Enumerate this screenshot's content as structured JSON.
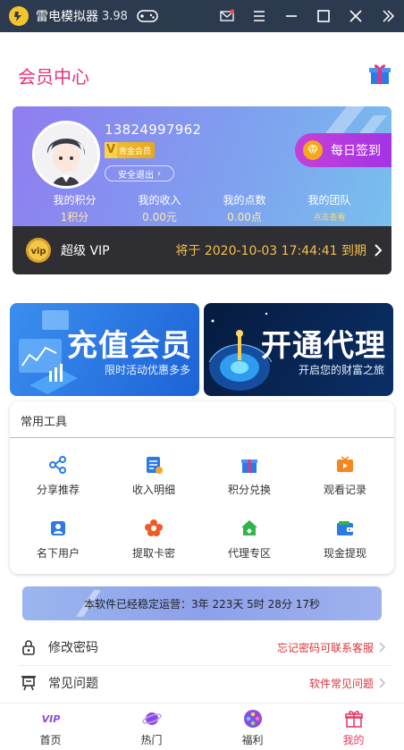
{
  "titlebar": {
    "app_name": "雷电模拟器",
    "version": "3.98"
  },
  "header": {
    "title": "会员中心"
  },
  "member": {
    "phone": "13824997962",
    "level_badge": "青金会员",
    "logout_label": "安全退出",
    "signin_label": "每日签到",
    "stats": [
      {
        "label": "我的积分",
        "value": "1积分"
      },
      {
        "label": "我的收入",
        "value": "0.00元"
      },
      {
        "label": "我的点数",
        "value": "0.00点"
      },
      {
        "label": "我的团队",
        "value": "点击查看"
      }
    ],
    "vip": {
      "label": "超级 VIP",
      "expire_text": "将于 2020-10-03 17:44:41 到期"
    }
  },
  "banners": {
    "left": {
      "title": "充值会员",
      "subtitle": "限时活动优惠多多"
    },
    "right": {
      "title": "开通代理",
      "subtitle": "开启您的财富之旅"
    }
  },
  "tools": {
    "title": "常用工具",
    "items": [
      {
        "label": "分享推荐",
        "icon": "share-icon"
      },
      {
        "label": "收入明细",
        "icon": "income-detail-icon"
      },
      {
        "label": "积分兑换",
        "icon": "gift-exchange-icon"
      },
      {
        "label": "观看记录",
        "icon": "play-history-icon"
      },
      {
        "label": "名下用户",
        "icon": "users-icon"
      },
      {
        "label": "提取卡密",
        "icon": "flower-key-icon"
      },
      {
        "label": "代理专区",
        "icon": "agent-house-icon"
      },
      {
        "label": "现金提现",
        "icon": "wallet-icon"
      }
    ]
  },
  "uptime": {
    "text": "本软件已经稳定运营：3年 223天 5时 28分 17秒"
  },
  "menu": [
    {
      "label": "修改密码",
      "right": "忘记密码可联系客服",
      "icon": "lock-icon"
    },
    {
      "label": "常见问题",
      "right": "软件常见问题",
      "icon": "faq-board-icon"
    }
  ],
  "bottom_nav": [
    {
      "label": "首页",
      "icon": "vip-home-icon"
    },
    {
      "label": "热门",
      "icon": "planet-icon"
    },
    {
      "label": "福利",
      "icon": "film-reel-icon"
    },
    {
      "label": "我的",
      "icon": "gift-box-icon"
    }
  ],
  "colors": {
    "brand_pink": "#e8327b",
    "titlebar_bg": "#2c3a4f",
    "vip_gold": "#f5c04c",
    "tool_blue": "#2b7ae6",
    "menu_red": "#d8363a"
  }
}
